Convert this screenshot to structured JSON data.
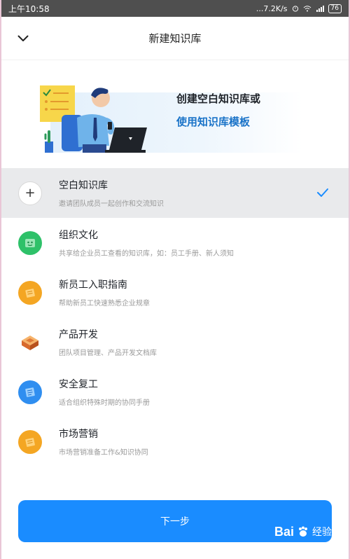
{
  "status_bar": {
    "time": "上午10:58",
    "network_speed": "...7.2K/s",
    "battery": "76"
  },
  "nav": {
    "title": "新建知识库"
  },
  "hero": {
    "line1": "创建空白知识库或",
    "line2": "使用知识库模板"
  },
  "items": [
    {
      "title": "空白知识库",
      "desc": "邀请团队成员一起创作和交流知识",
      "icon": "plus-icon",
      "color": "#ffffff",
      "selected": true
    },
    {
      "title": "组织文化",
      "desc": "共享给企业员工查看的知识库，如：员工手册、新人须知",
      "icon": "culture-icon",
      "color": "#2ec169"
    },
    {
      "title": "新员工入职指南",
      "desc": "帮助新员工快速熟悉企业规章",
      "icon": "onboarding-icon",
      "color": "#f4a623"
    },
    {
      "title": "产品开发",
      "desc": "团队项目管理、产品开发文档库",
      "icon": "product-icon",
      "color": "#f08a4b"
    },
    {
      "title": "安全复工",
      "desc": "适合组织特殊时期的协同手册",
      "icon": "safety-icon",
      "color": "#2f8ef0"
    },
    {
      "title": "市场营销",
      "desc": "市场营销准备工作&知识协同",
      "icon": "marketing-icon",
      "color": "#f4a623"
    }
  ],
  "next_button": {
    "label": "下一步"
  },
  "watermark": {
    "brand": "Bai",
    "suffix": "经验"
  },
  "colors": {
    "accent": "#1a8cff",
    "selected_bg": "#e9eaec",
    "status_bg": "#4f4f4f"
  }
}
